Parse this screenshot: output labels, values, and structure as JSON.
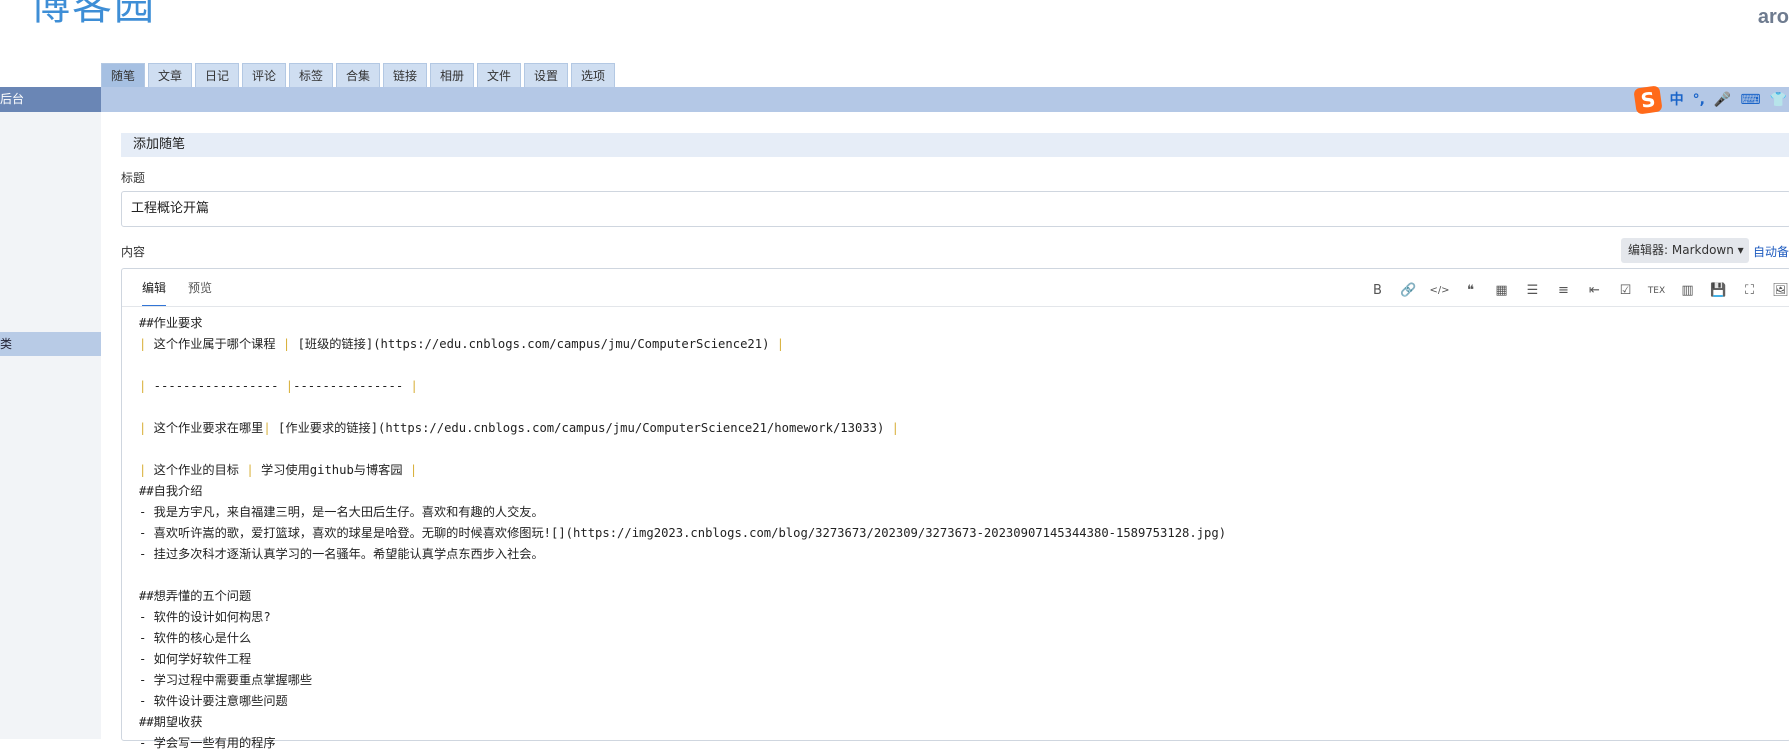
{
  "header": {
    "logo": "博客园",
    "username": "aro"
  },
  "tabs": [
    "随笔",
    "文章",
    "日记",
    "评论",
    "标签",
    "合集",
    "链接",
    "相册",
    "文件",
    "设置",
    "选项"
  ],
  "sidebar": {
    "head": "后台",
    "selected": "类"
  },
  "ime": {
    "logo": "S",
    "mode": "中",
    "punct": "°,",
    "mic": "🎤",
    "keyboard": "⌨",
    "skin": "👕"
  },
  "panel": {
    "title": "添加随笔"
  },
  "form": {
    "title_label": "标题",
    "title_value": "工程概论开篇",
    "content_label": "内容",
    "editor_select": "编辑器: Markdown ▾",
    "auto_save": "自动备"
  },
  "editor": {
    "tabs": [
      "编辑",
      "预览"
    ],
    "toolbar": [
      {
        "name": "bold-icon",
        "glyph": "B"
      },
      {
        "name": "link-icon",
        "glyph": "🔗"
      },
      {
        "name": "code-icon",
        "glyph": "</>"
      },
      {
        "name": "quote-icon",
        "glyph": "❝"
      },
      {
        "name": "table-icon",
        "glyph": "▦"
      },
      {
        "name": "bullet-list-icon",
        "glyph": "☰"
      },
      {
        "name": "numbered-list-icon",
        "glyph": "≡"
      },
      {
        "name": "outline-icon",
        "glyph": "⇤"
      },
      {
        "name": "checkbox-icon",
        "glyph": "☑"
      },
      {
        "name": "tex-icon",
        "glyph": "TEX"
      },
      {
        "name": "split-view-icon",
        "glyph": "▥"
      },
      {
        "name": "save-icon",
        "glyph": "💾"
      },
      {
        "name": "fullscreen-icon",
        "glyph": "⛶"
      },
      {
        "name": "image-icon",
        "glyph": "🖼"
      }
    ],
    "lines": [
      "##作业要求",
      "| 这个作业属于哪个课程 | [班级的链接](https://edu.cnblogs.com/campus/jmu/ComputerScience21) |",
      "",
      "| ----------------- |--------------- |",
      "",
      "| 这个作业要求在哪里| [作业要求的链接](https://edu.cnblogs.com/campus/jmu/ComputerScience21/homework/13033) |",
      "",
      "| 这个作业的目标 | 学习使用github与博客园 |",
      "##自我介绍",
      "- 我是方宇凡，来自福建三明，是一名大田后生仔。喜欢和有趣的人交友。",
      "- 喜欢听许嵩的歌，爱打篮球，喜欢的球星是哈登。无聊的时候喜欢修图玩![](https://img2023.cnblogs.com/blog/3273673/202309/3273673-20230907145344380-1589753128.jpg)",
      "- 挂过多次科才逐渐认真学习的一名骚年。希望能认真学点东西步入社会。",
      "",
      "##想弄懂的五个问题",
      "- 软件的设计如何构思?",
      "- 软件的核心是什么",
      "- 如何学好软件工程",
      "- 学习过程中需要重点掌握哪些",
      "- 软件设计要注意哪些问题",
      "##期望收获",
      "- 学会写一些有用的程序"
    ]
  }
}
